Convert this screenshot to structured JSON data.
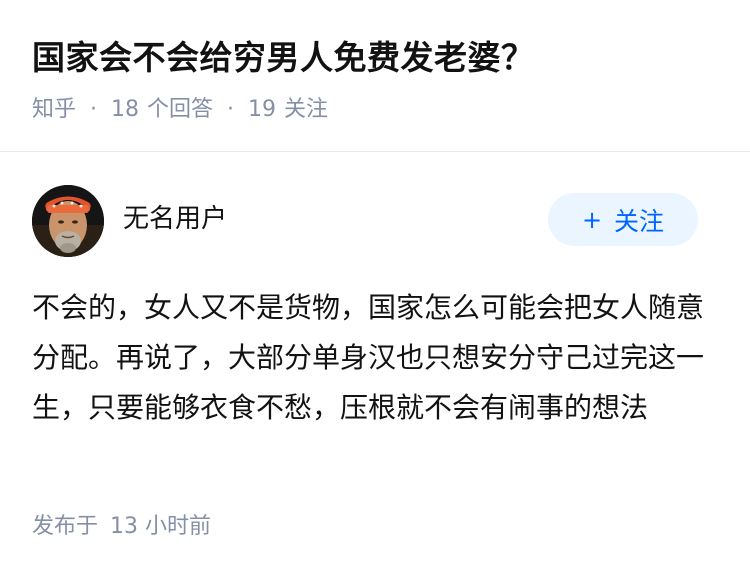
{
  "question": {
    "title": "国家会不会给穷男人免费发老婆？",
    "source": "知乎",
    "answers_count": "18",
    "answers_label": "个回答",
    "followers_count": "19",
    "followers_label": "关注"
  },
  "answer": {
    "author_name": "无名用户",
    "follow_button": {
      "icon": "+",
      "label": "关注"
    },
    "content": "不会的，女人又不是货物，国家怎么可能会把女人随意分配。再说了，大部分单身汉也只想安分守己过完这一生，只要能够衣食不愁，压根就不会有闹事的想法",
    "published_label": "发布于",
    "published_time": "13 小时前"
  },
  "colors": {
    "meta_text": "#8590a6",
    "follow_bg": "#ebf5ff",
    "follow_text": "#0066ff",
    "divider": "#ebebeb"
  }
}
